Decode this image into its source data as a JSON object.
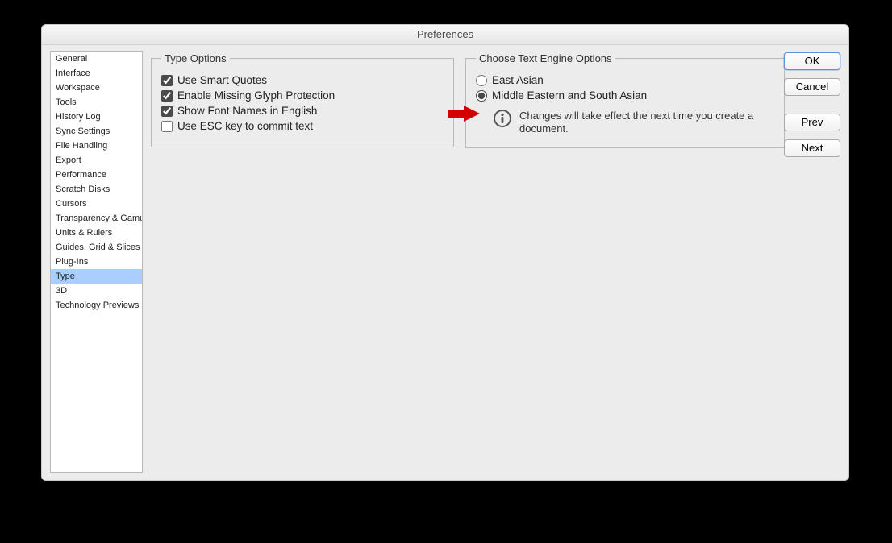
{
  "title": "Preferences",
  "sidebar": [
    {
      "label": "General"
    },
    {
      "label": "Interface"
    },
    {
      "label": "Workspace"
    },
    {
      "label": "Tools"
    },
    {
      "label": "History Log"
    },
    {
      "label": "Sync Settings"
    },
    {
      "label": "File Handling"
    },
    {
      "label": "Export"
    },
    {
      "label": "Performance"
    },
    {
      "label": "Scratch Disks"
    },
    {
      "label": "Cursors"
    },
    {
      "label": "Transparency & Gamut"
    },
    {
      "label": "Units & Rulers"
    },
    {
      "label": "Guides, Grid & Slices"
    },
    {
      "label": "Plug-Ins"
    },
    {
      "label": "Type",
      "selected": true
    },
    {
      "label": "3D"
    },
    {
      "label": "Technology Previews"
    }
  ],
  "type_panel": {
    "legend": "Type Options",
    "opts": [
      {
        "label": "Use Smart Quotes",
        "checked": true
      },
      {
        "label": "Enable Missing Glyph Protection",
        "checked": true
      },
      {
        "label": "Show Font Names in English",
        "checked": true
      },
      {
        "label": "Use ESC key to commit text",
        "checked": false
      }
    ]
  },
  "engine_panel": {
    "legend": "Choose Text Engine Options",
    "opts": [
      {
        "label": "East Asian",
        "checked": false
      },
      {
        "label": "Middle Eastern and South Asian",
        "checked": true
      }
    ],
    "info": "Changes will take effect the next time you create a document."
  },
  "buttons": {
    "ok": "OK",
    "cancel": "Cancel",
    "prev": "Prev",
    "next": "Next"
  }
}
